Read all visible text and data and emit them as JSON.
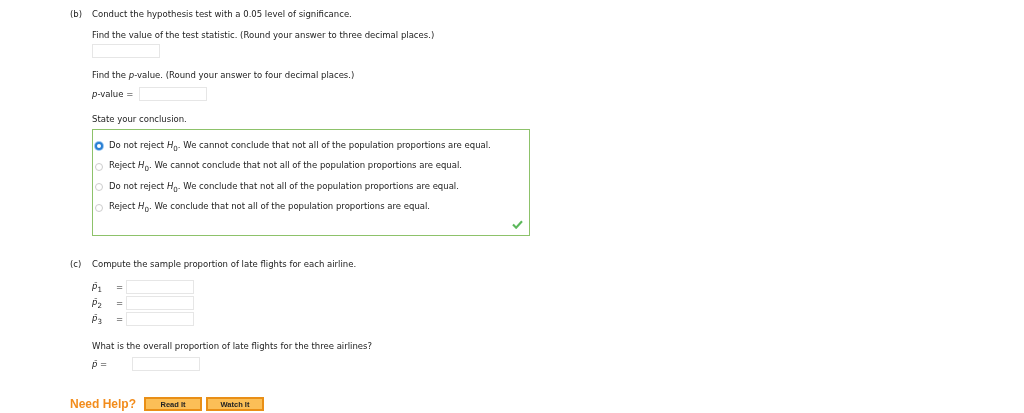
{
  "part_b": {
    "label": "(b)",
    "title": "Conduct the hypothesis test with a 0.05 level of significance.",
    "statistic_prompt": "Find the value of the test statistic. (Round your answer to three decimal places.)",
    "p_prompt": "Find the *p*-value. (Round your answer to four decimal places.)",
    "p_label": "*p*-value =",
    "conclusion_prompt": "State your conclusion.",
    "correct": true,
    "options": [
      {
        "text": "Do not reject *H*$_{0}$. We cannot conclude that not all of the population proportions are equal.",
        "selected": true
      },
      {
        "text": "Reject *H*$_{0}$. We cannot conclude that not all of the population proportions are equal.",
        "selected": false
      },
      {
        "text": "Do not reject *H*$_{0}$. We conclude that not all of the population proportions are equal.",
        "selected": false
      },
      {
        "text": "Reject *H*$_{0}$. We conclude that not all of the population proportions are equal.",
        "selected": false
      }
    ]
  },
  "part_c": {
    "label": "(c)",
    "title": "Compute the sample proportion of late flights for each airline.",
    "proportions": [
      {
        "symbol": "*p̄*$_{1}$",
        "eq": "="
      },
      {
        "symbol": "*p̄*$_{2}$",
        "eq": "="
      },
      {
        "symbol": "*p̄*$_{3}$",
        "eq": "="
      }
    ],
    "overall_prompt": "What is the overall proportion of late flights for the three airlines?",
    "overall_label": "*p̄* ="
  },
  "help": {
    "label": "Need Help?",
    "buttons": [
      "Read It",
      "Watch It"
    ]
  }
}
